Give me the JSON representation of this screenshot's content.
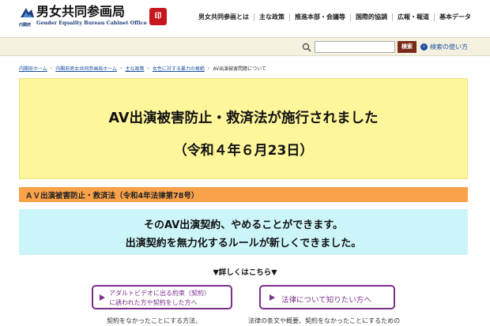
{
  "header": {
    "cabinet_label": "内閣府",
    "title": "男女共同参画局",
    "subtitle": "Gender Equality Bureau Cabinet Office",
    "seal_text": "印",
    "nav": [
      "男女共同参画とは",
      "主な政策",
      "推進本部・会議等",
      "国際的協調",
      "広報・報道",
      "基本データ"
    ]
  },
  "search": {
    "placeholder": "",
    "button_label": "検索",
    "help_label": "検索の使い方"
  },
  "breadcrumb": {
    "items": [
      "内閣府ホーム",
      "内閣府男女共同参画局ホーム",
      "主な政策",
      "女性に対する暴力の根絶"
    ],
    "current": "AV出演被害問題について"
  },
  "banner": {
    "line1": "AV出演被害防止・救済法が施行されました",
    "line2": "（令和４年６月23日）"
  },
  "law_bar": {
    "text": "ＡＶ出演被害防止・救済法（令和4年法律第78号）"
  },
  "message": {
    "line1": "そのAV出演契約、やめることができます。",
    "line2": "出演契約を無力化するルールが新しくできました。"
  },
  "details_label": "▼詳しくはこちら▼",
  "buttons": {
    "left_line1": "アダルトビデオに出る約束（契約）",
    "left_line2": "に誘われた方や契約をした方へ",
    "right_label": "法律について知りたい方へ"
  },
  "footer_text": {
    "left": "契約をなかったことにする方法、",
    "right": "法律の条文や概要、契約をなかったことにするための"
  },
  "colors": {
    "banner_yellow": "#fef69a",
    "law_orange": "#f9a24a",
    "message_cyan": "#ccf5fa",
    "button_purple": "#7a2e8c",
    "search_bar": "#f5f1e1"
  }
}
